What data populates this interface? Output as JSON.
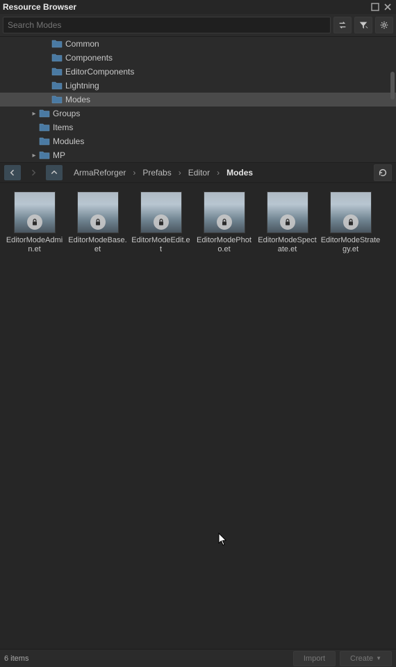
{
  "window": {
    "title": "Resource Browser"
  },
  "search": {
    "placeholder": "Search Modes"
  },
  "tree": {
    "items": [
      {
        "label": "Common",
        "depth": 3,
        "arrow": "",
        "selected": false
      },
      {
        "label": "Components",
        "depth": 3,
        "arrow": "",
        "selected": false
      },
      {
        "label": "EditorComponents",
        "depth": 3,
        "arrow": "",
        "selected": false
      },
      {
        "label": "Lightning",
        "depth": 3,
        "arrow": "",
        "selected": false
      },
      {
        "label": "Modes",
        "depth": 3,
        "arrow": "",
        "selected": true
      },
      {
        "label": "Groups",
        "depth": 2,
        "arrow": "▸",
        "selected": false
      },
      {
        "label": "Items",
        "depth": 2,
        "arrow": "",
        "selected": false
      },
      {
        "label": "Modules",
        "depth": 2,
        "arrow": "",
        "selected": false
      },
      {
        "label": "MP",
        "depth": 2,
        "arrow": "▸",
        "selected": false
      }
    ]
  },
  "breadcrumb": {
    "0": "ArmaReforger",
    "1": "Prefabs",
    "2": "Editor",
    "3": "Modes"
  },
  "grid": {
    "items": [
      {
        "label": "EditorModeAdmin.et"
      },
      {
        "label": "EditorModeBase.et"
      },
      {
        "label": "EditorModeEdit.et"
      },
      {
        "label": "EditorModePhoto.et"
      },
      {
        "label": "EditorModeSpectate.et"
      },
      {
        "label": "EditorModeStrategy.et"
      }
    ]
  },
  "status": {
    "count": "6 items",
    "import": "Import",
    "create": "Create"
  }
}
